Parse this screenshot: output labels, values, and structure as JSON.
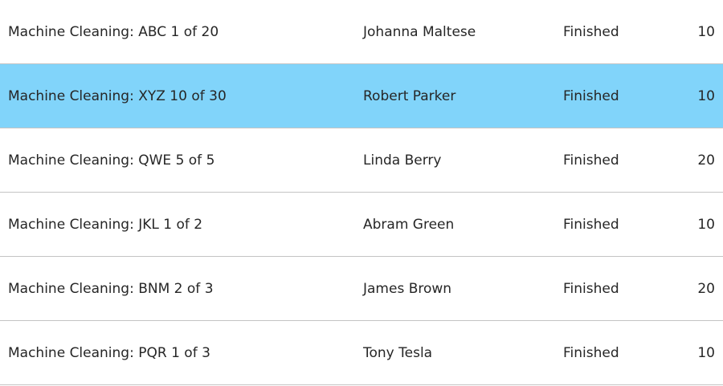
{
  "colors": {
    "selected_row": "#81d4fa",
    "divider": "#c4c4c4",
    "text": "#262626"
  },
  "rows": [
    {
      "task": "Machine Cleaning: ABC 1 of 20",
      "assignee": "Johanna Maltese",
      "status": "Finished",
      "value": "10",
      "selected": false
    },
    {
      "task": "Machine Cleaning: XYZ 10 of 30",
      "assignee": "Robert Parker",
      "status": "Finished",
      "value": "10",
      "selected": true
    },
    {
      "task": "Machine Cleaning: QWE 5 of 5",
      "assignee": "Linda Berry",
      "status": "Finished",
      "value": "20",
      "selected": false
    },
    {
      "task": "Machine Cleaning: JKL 1 of 2",
      "assignee": "Abram Green",
      "status": "Finished",
      "value": "10",
      "selected": false
    },
    {
      "task": "Machine Cleaning: BNM 2 of 3",
      "assignee": "James Brown",
      "status": "Finished",
      "value": "20",
      "selected": false
    },
    {
      "task": "Machine Cleaning: PQR 1 of 3",
      "assignee": "Tony Tesla",
      "status": "Finished",
      "value": "10",
      "selected": false
    }
  ]
}
